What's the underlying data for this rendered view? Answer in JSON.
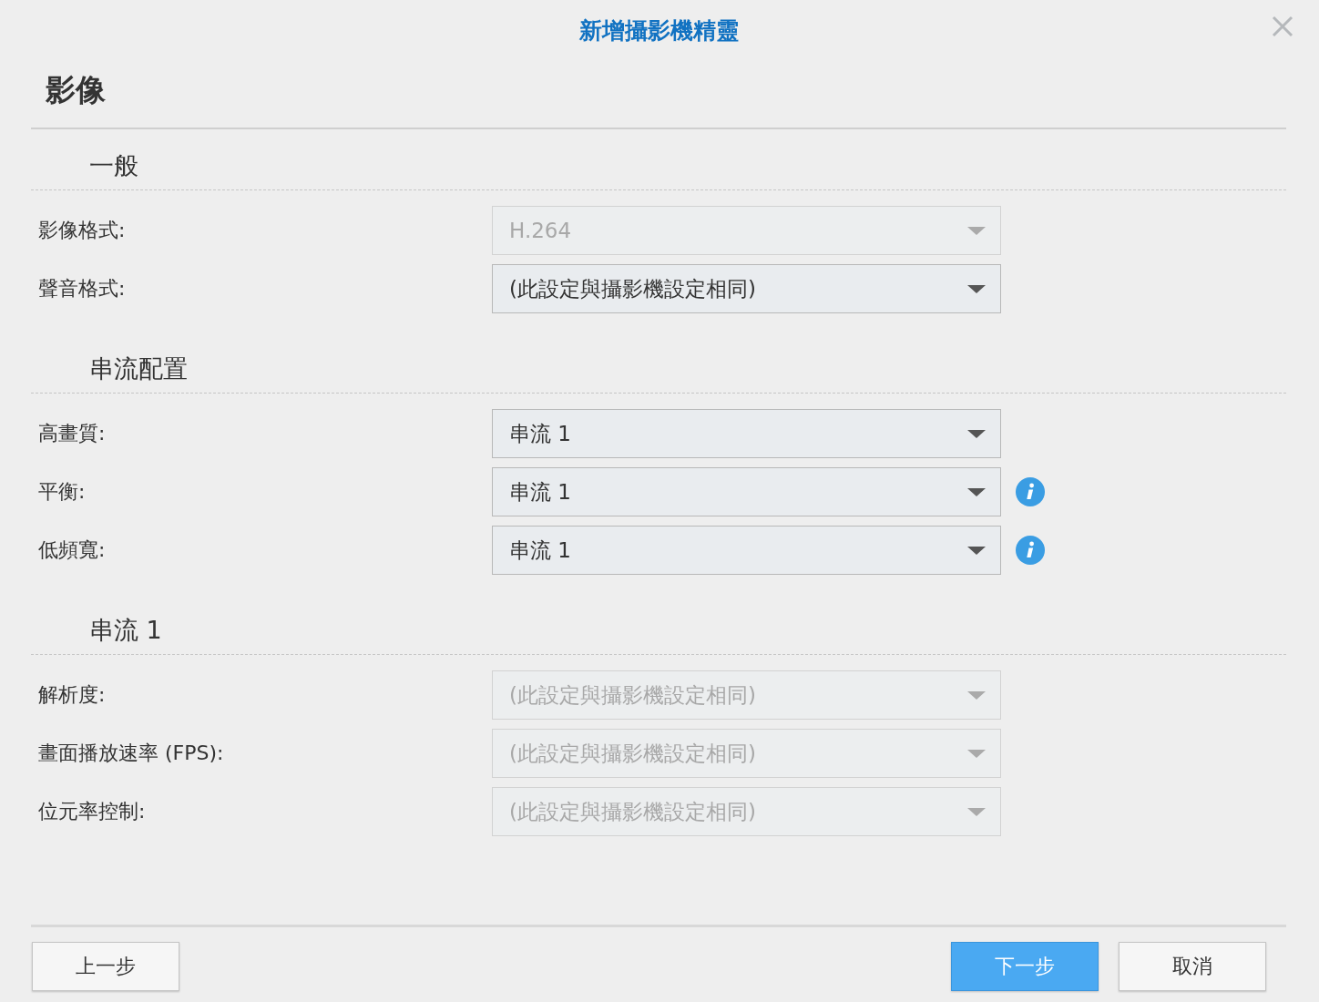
{
  "dialog": {
    "title": "新增攝影機精靈",
    "page_title": "影像"
  },
  "sections": [
    {
      "title": "一般",
      "rows": [
        {
          "label": "影像格式:",
          "value": "H.264",
          "disabled": true,
          "info": false
        },
        {
          "label": "聲音格式:",
          "value": "(此設定與攝影機設定相同)",
          "disabled": false,
          "info": false
        }
      ]
    },
    {
      "title": "串流配置",
      "rows": [
        {
          "label": "高畫質:",
          "value": "串流 1",
          "disabled": false,
          "info": false
        },
        {
          "label": "平衡:",
          "value": "串流 1",
          "disabled": false,
          "info": true
        },
        {
          "label": "低頻寬:",
          "value": "串流 1",
          "disabled": false,
          "info": true
        }
      ]
    },
    {
      "title": "串流 1",
      "rows": [
        {
          "label": "解析度:",
          "value": "(此設定與攝影機設定相同)",
          "disabled": true,
          "info": false
        },
        {
          "label": "畫面播放速率 (FPS):",
          "value": "(此設定與攝影機設定相同)",
          "disabled": true,
          "info": false
        },
        {
          "label": "位元率控制:",
          "value": "(此設定與攝影機設定相同)",
          "disabled": true,
          "info": false
        }
      ]
    }
  ],
  "buttons": [
    {
      "label": "上一步",
      "kind": "secondary"
    },
    {
      "label": "下一步",
      "kind": "primary"
    },
    {
      "label": "取消",
      "kind": "secondary"
    }
  ]
}
